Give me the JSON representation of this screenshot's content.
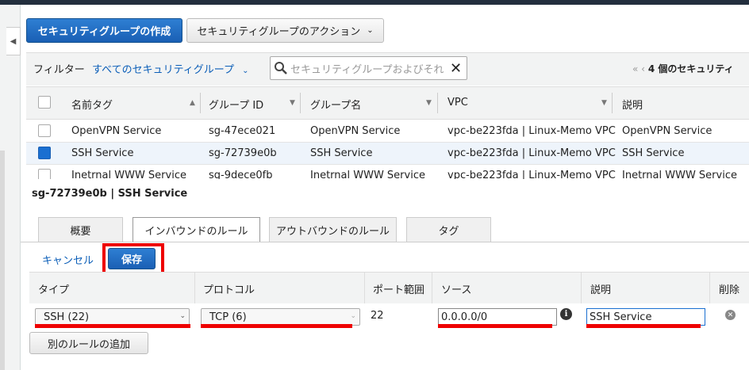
{
  "toolbar": {
    "create_label": "セキュリティグループの作成",
    "actions_label": "セキュリティグループのアクション"
  },
  "filter": {
    "label": "フィルター",
    "value": "すべてのセキュリティグループ",
    "search_placeholder": "セキュリティグループおよびそれ"
  },
  "pager": {
    "text": "4 個のセキュリティ"
  },
  "table": {
    "columns": [
      "名前タグ",
      "グループ ID",
      "グループ名",
      "VPC",
      "説明"
    ],
    "rows": [
      {
        "name_tag": "OpenVPN Service",
        "group_id": "sg-47ece021",
        "group_name": "OpenVPN Service",
        "vpc": "vpc-be223fda | Linux-Memo VPC",
        "description": "OpenVPN Service",
        "selected": false
      },
      {
        "name_tag": "SSH Service",
        "group_id": "sg-72739e0b",
        "group_name": "SSH Service",
        "vpc": "vpc-be223fda | Linux-Memo VPC",
        "description": "SSH Service",
        "selected": true
      },
      {
        "name_tag": "Inetrnal WWW Service",
        "group_id": "sg-9dece0fb",
        "group_name": "Inetrnal WWW Service",
        "vpc": "vpc-be223fda | Linux-Memo VPC",
        "description": "Inetrnal WWW Service",
        "selected": false
      }
    ]
  },
  "detail": {
    "title": "sg-72739e0b | SSH Service",
    "tabs": [
      "概要",
      "インバウンドのルール",
      "アウトバウンドのルール",
      "タグ"
    ],
    "active_tab": "インバウンドのルール",
    "cancel_label": "キャンセル",
    "save_label": "保存",
    "rules_columns": [
      "タイプ",
      "プロトコル",
      "ポート範囲",
      "ソース",
      "説明",
      "削除"
    ],
    "rule": {
      "type": "SSH (22)",
      "protocol": "TCP (6)",
      "port_range": "22",
      "source": "0.0.0.0/0",
      "description": "SSH Service"
    },
    "add_rule_label": "別のルールの追加"
  },
  "colors": {
    "primary_blue": "#1a5fb4",
    "link_blue": "#0b5eb8",
    "highlight_red": "#e00000"
  }
}
